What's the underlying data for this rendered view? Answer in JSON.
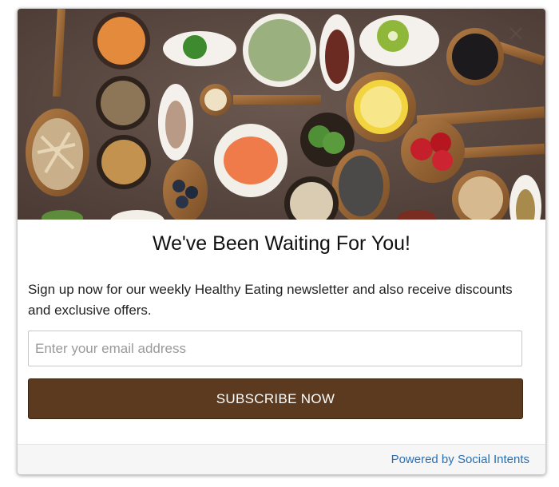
{
  "popup": {
    "title": "We've Been Waiting For You!",
    "description": "Sign up now for our weekly Healthy Eating newsletter and also receive discounts and exclusive offers.",
    "email_placeholder": "Enter your email address",
    "email_value": "",
    "subscribe_label": "SUBSCRIBE NOW",
    "powered_by": "Powered by Social Intents",
    "hero_image": "superfood-bowls-and-wooden-spoons",
    "close_icon": "close-icon"
  },
  "colors": {
    "button": "#5c3a1f",
    "link": "#2a6fb0",
    "hero_background": "#5a4942"
  }
}
